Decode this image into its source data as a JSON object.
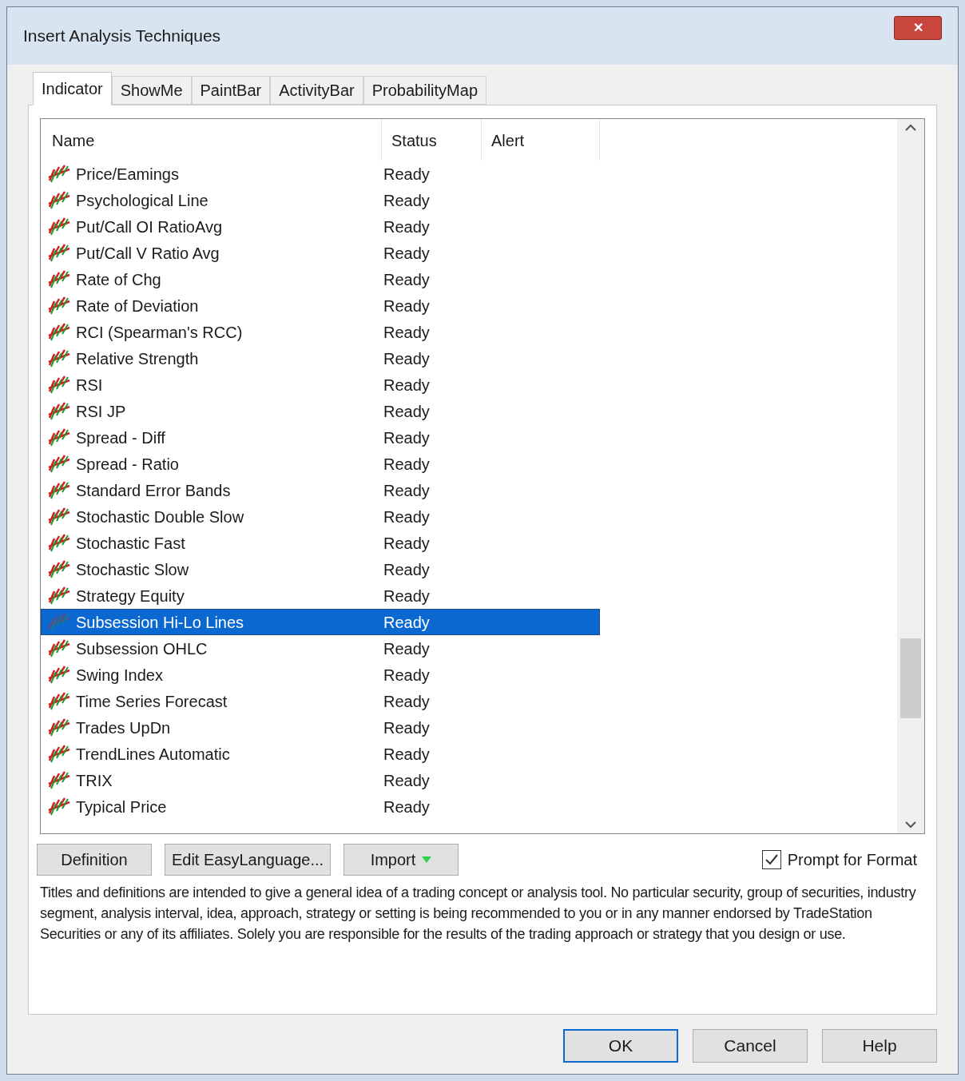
{
  "window": {
    "title": "Insert Analysis Techniques",
    "close": "✕"
  },
  "tabs": [
    {
      "label": "Indicator",
      "selected": true
    },
    {
      "label": "ShowMe",
      "selected": false
    },
    {
      "label": "PaintBar",
      "selected": false
    },
    {
      "label": "ActivityBar",
      "selected": false
    },
    {
      "label": "ProbabilityMap",
      "selected": false
    }
  ],
  "table": {
    "columns": [
      "Name",
      "Status",
      "Alert"
    ],
    "rows": [
      {
        "name": "Price/Eamings",
        "status": "Ready",
        "selected": false
      },
      {
        "name": "Psychological Line",
        "status": "Ready",
        "selected": false
      },
      {
        "name": "Put/Call OI RatioAvg",
        "status": "Ready",
        "selected": false
      },
      {
        "name": "Put/Call V Ratio Avg",
        "status": "Ready",
        "selected": false
      },
      {
        "name": "Rate of Chg",
        "status": "Ready",
        "selected": false
      },
      {
        "name": "Rate of Deviation",
        "status": "Ready",
        "selected": false
      },
      {
        "name": "RCI (Spearman's RCC)",
        "status": "Ready",
        "selected": false
      },
      {
        "name": "Relative Strength",
        "status": "Ready",
        "selected": false
      },
      {
        "name": "RSI",
        "status": "Ready",
        "selected": false
      },
      {
        "name": "RSI JP",
        "status": "Ready",
        "selected": false
      },
      {
        "name": "Spread - Diff",
        "status": "Ready",
        "selected": false
      },
      {
        "name": "Spread - Ratio",
        "status": "Ready",
        "selected": false
      },
      {
        "name": "Standard Error Bands",
        "status": "Ready",
        "selected": false
      },
      {
        "name": "Stochastic Double Slow",
        "status": "Ready",
        "selected": false
      },
      {
        "name": "Stochastic Fast",
        "status": "Ready",
        "selected": false
      },
      {
        "name": "Stochastic Slow",
        "status": "Ready",
        "selected": false
      },
      {
        "name": "Strategy Equity",
        "status": "Ready",
        "selected": false
      },
      {
        "name": "Subsession Hi-Lo Lines",
        "status": "Ready",
        "selected": true
      },
      {
        "name": "Subsession OHLC",
        "status": "Ready",
        "selected": false
      },
      {
        "name": "Swing Index",
        "status": "Ready",
        "selected": false
      },
      {
        "name": "Time Series Forecast",
        "status": "Ready",
        "selected": false
      },
      {
        "name": "Trades UpDn",
        "status": "Ready",
        "selected": false
      },
      {
        "name": "TrendLines Automatic",
        "status": "Ready",
        "selected": false
      },
      {
        "name": "TRIX",
        "status": "Ready",
        "selected": false
      },
      {
        "name": "Typical Price",
        "status": "Ready",
        "selected": false
      }
    ]
  },
  "actions": [
    "Definition",
    "Edit EasyLanguage...",
    "Import"
  ],
  "prompt_for_format": {
    "label": "Prompt for Format",
    "checked": true
  },
  "disclaimer": "Titles and definitions are intended to give a general idea of a trading concept or analysis tool. No particular security, group of securities, industry segment, analysis interval, idea, approach, strategy or setting is being recommended to you or in any manner endorsed by TradeStation Securities or any of its affiliates. Solely you are responsible for the results of the trading approach or strategy that you design or use.",
  "buttons": [
    {
      "label": "OK",
      "default": true
    },
    {
      "label": "Cancel",
      "default": false
    },
    {
      "label": "Help",
      "default": false
    }
  ]
}
